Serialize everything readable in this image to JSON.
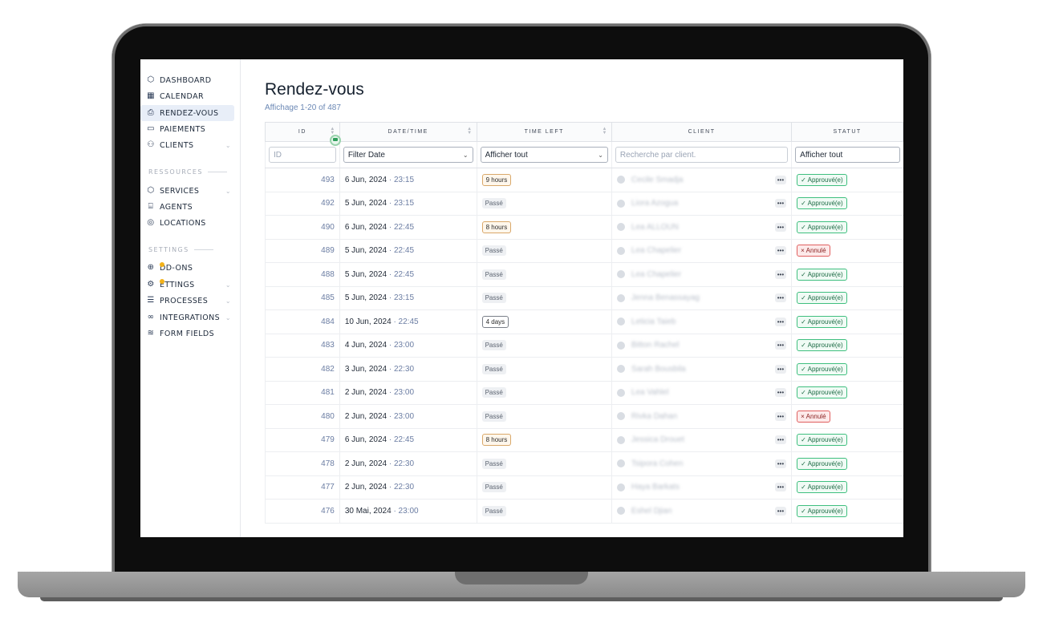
{
  "sidebar": {
    "items": [
      {
        "label": "DASHBOARD",
        "icon": "cube-icon"
      },
      {
        "label": "CALENDAR",
        "icon": "calendar-icon"
      },
      {
        "label": "RENDEZ-VOUS",
        "icon": "inbox-icon",
        "active": true
      },
      {
        "label": "PAIEMENTS",
        "icon": "card-icon"
      },
      {
        "label": "CLIENTS",
        "icon": "users-icon",
        "chevron": true
      }
    ],
    "section_resources": "RESSOURCES",
    "resources": [
      {
        "label": "SERVICES",
        "icon": "cube-icon",
        "chevron": true
      },
      {
        "label": "AGENTS",
        "icon": "building-icon"
      },
      {
        "label": "LOCATIONS",
        "icon": "pin-icon"
      }
    ],
    "section_settings": "SETTINGS",
    "settings": [
      {
        "label": "DD-ONS",
        "icon": "plus-circle-icon"
      },
      {
        "label": "ETTINGS",
        "icon": "gear-icon",
        "chevron": true
      },
      {
        "label": "PROCESSES",
        "icon": "layers-icon",
        "chevron": true
      },
      {
        "label": "INTEGRATIONS",
        "icon": "link-icon",
        "chevron": true
      },
      {
        "label": "FORM FIELDS",
        "icon": "stack-icon"
      }
    ]
  },
  "page": {
    "title": "Rendez-vous",
    "subtitle": "Affichage 1-20 of 487"
  },
  "table": {
    "headers": {
      "id": "ID",
      "datetime": "DATE/TIME",
      "timeleft": "TIME LEFT",
      "client": "CLIENT",
      "statut": "STATUT"
    },
    "filters": {
      "id_placeholder": "ID",
      "date": "Filter Date",
      "timeleft": "Afficher tout",
      "client_placeholder": "Recherche par client.",
      "statut": "Afficher tout"
    },
    "rows": [
      {
        "id": "493",
        "date": "6 Jun, 2024",
        "time": "23:15",
        "left": "9 hours",
        "left_type": "future",
        "client": "Cecile Smadja",
        "status": "✓ Approuvé(e)",
        "status_type": "ok"
      },
      {
        "id": "492",
        "date": "5 Jun, 2024",
        "time": "23:15",
        "left": "Passé",
        "left_type": "past",
        "client": "Liora Azogua",
        "status": "✓ Approuvé(e)",
        "status_type": "ok"
      },
      {
        "id": "490",
        "date": "6 Jun, 2024",
        "time": "22:45",
        "left": "8 hours",
        "left_type": "future",
        "client": "Lea ALLOUN",
        "status": "✓ Approuvé(e)",
        "status_type": "ok"
      },
      {
        "id": "489",
        "date": "5 Jun, 2024",
        "time": "22:45",
        "left": "Passé",
        "left_type": "past",
        "client": "Lea Chapelier",
        "status": "× Annulé",
        "status_type": "no"
      },
      {
        "id": "488",
        "date": "5 Jun, 2024",
        "time": "22:45",
        "left": "Passé",
        "left_type": "past",
        "client": "Lea Chapelier",
        "status": "✓ Approuvé(e)",
        "status_type": "ok"
      },
      {
        "id": "485",
        "date": "5 Jun, 2024",
        "time": "23:15",
        "left": "Passé",
        "left_type": "past",
        "client": "Jenna Benassayag",
        "status": "✓ Approuvé(e)",
        "status_type": "ok"
      },
      {
        "id": "484",
        "date": "10 Jun, 2024",
        "time": "22:45",
        "left": "4 days",
        "left_type": "days",
        "client": "Leticia Taieb",
        "status": "✓ Approuvé(e)",
        "status_type": "ok"
      },
      {
        "id": "483",
        "date": "4 Jun, 2024",
        "time": "23:00",
        "left": "Passé",
        "left_type": "past",
        "client": "Bitton Rachel",
        "status": "✓ Approuvé(e)",
        "status_type": "ok"
      },
      {
        "id": "482",
        "date": "3 Jun, 2024",
        "time": "22:30",
        "left": "Passé",
        "left_type": "past",
        "client": "Sarah Bousbila",
        "status": "✓ Approuvé(e)",
        "status_type": "ok"
      },
      {
        "id": "481",
        "date": "2 Jun, 2024",
        "time": "23:00",
        "left": "Passé",
        "left_type": "past",
        "client": "Lea Vahlel",
        "status": "✓ Approuvé(e)",
        "status_type": "ok"
      },
      {
        "id": "480",
        "date": "2 Jun, 2024",
        "time": "23:00",
        "left": "Passé",
        "left_type": "past",
        "client": "Rivka Dahan",
        "status": "× Annulé",
        "status_type": "no"
      },
      {
        "id": "479",
        "date": "6 Jun, 2024",
        "time": "22:45",
        "left": "8 hours",
        "left_type": "future",
        "client": "Jessica Drouet",
        "status": "✓ Approuvé(e)",
        "status_type": "ok"
      },
      {
        "id": "478",
        "date": "2 Jun, 2024",
        "time": "22:30",
        "left": "Passé",
        "left_type": "past",
        "client": "Tsipora Cohen",
        "status": "✓ Approuvé(e)",
        "status_type": "ok"
      },
      {
        "id": "477",
        "date": "2 Jun, 2024",
        "time": "22:30",
        "left": "Passé",
        "left_type": "past",
        "client": "Haya Barkats",
        "status": "✓ Approuvé(e)",
        "status_type": "ok"
      },
      {
        "id": "476",
        "date": "30 Mai, 2024",
        "time": "23:00",
        "left": "Passé",
        "left_type": "past",
        "client": "Eshel Djian",
        "status": "✓ Approuvé(e)",
        "status_type": "ok"
      }
    ]
  }
}
